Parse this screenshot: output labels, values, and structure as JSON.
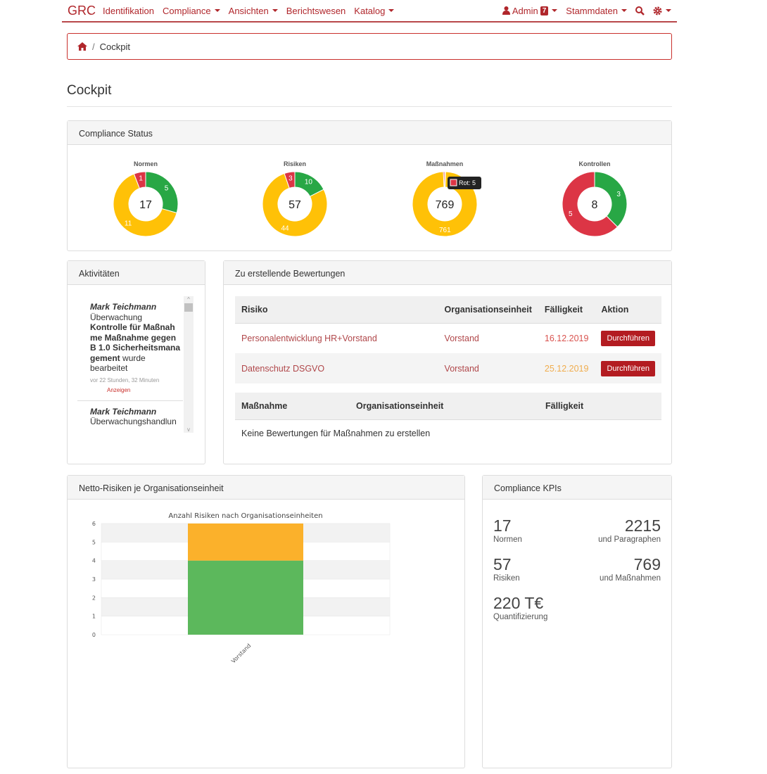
{
  "nav": {
    "brand": "GRC",
    "items": [
      {
        "label": "Identifikation",
        "caret": false
      },
      {
        "label": "Compliance",
        "caret": true
      },
      {
        "label": "Ansichten",
        "caret": true
      },
      {
        "label": "Berichtswesen",
        "caret": false
      },
      {
        "label": "Katalog",
        "caret": true
      }
    ],
    "user": "Admin",
    "user_badge": "7",
    "stammdaten": "Stammdaten",
    "icons": [
      "user-icon",
      "search-icon",
      "gear-icon"
    ]
  },
  "breadcrumb": {
    "current": "Cockpit",
    "icon": "home-icon"
  },
  "page_title": "Cockpit",
  "colors": {
    "green": "#28a745",
    "yellow": "#ffc107",
    "red": "#dc3545",
    "accent": "#b0262b",
    "bar_green": "#5cb85c",
    "bar_orange": "#fbb12b"
  },
  "compliance_status": {
    "title": "Compliance Status",
    "donuts": [
      {
        "title": "Normen",
        "total": "17",
        "segments": [
          {
            "color": "green",
            "value": 5,
            "label": "5"
          },
          {
            "color": "yellow",
            "value": 11,
            "label": "11"
          },
          {
            "color": "red",
            "value": 1,
            "label": "1"
          }
        ]
      },
      {
        "title": "Risiken",
        "total": "57",
        "segments": [
          {
            "color": "green",
            "value": 10,
            "label": "10"
          },
          {
            "color": "yellow",
            "value": 44,
            "label": "44"
          },
          {
            "color": "red",
            "value": 3,
            "label": "3"
          }
        ]
      },
      {
        "title": "Maßnahmen",
        "total": "769",
        "segments": [
          {
            "color": "green",
            "value": 3,
            "label": ""
          },
          {
            "color": "yellow",
            "value": 761,
            "label": "761"
          },
          {
            "color": "red",
            "value": 5,
            "label": ""
          }
        ],
        "tooltip": "Rot: 5"
      },
      {
        "title": "Kontrollen",
        "total": "8",
        "segments": [
          {
            "color": "green",
            "value": 3,
            "label": "3"
          },
          {
            "color": "red",
            "value": 5,
            "label": "5"
          }
        ]
      }
    ]
  },
  "activities": {
    "title": "Aktivitäten",
    "items": [
      {
        "user": "Mark Teichmann",
        "type": "Überwachung",
        "object": "Kontrolle für Maßnahme Maßnahme gegen B 1.0 Sicherheitsmanagement",
        "action": "wurde bearbeitet",
        "time": "vor 22 Stunden, 32 Minuten",
        "link": "Anzeigen"
      },
      {
        "user": "Mark Teichmann",
        "type": "Überwachungshandlun"
      }
    ]
  },
  "assessments": {
    "title": "Zu erstellende Bewertungen",
    "risk_headers": [
      "Risiko",
      "Organisationseinheit",
      "Fälligkeit",
      "Aktion"
    ],
    "risk_rows": [
      {
        "risk": "Personalentwicklung HR+Vorstand",
        "unit": "Vorstand",
        "due": "16.12.2019",
        "due_color": "#d9534f",
        "action": "Durchführen"
      },
      {
        "risk": "Datenschutz DSGVO",
        "unit": "Vorstand",
        "due": "25.12.2019",
        "due_color": "#f0ad4e",
        "action": "Durchführen"
      }
    ],
    "measure_headers": [
      "Maßnahme",
      "Organisationseinheit",
      "Fälligkeit"
    ],
    "measure_empty": "Keine Bewertungen für Maßnahmen zu erstellen"
  },
  "net_risks": {
    "title": "Netto-Risiken je Organisationseinheit"
  },
  "chart_data": {
    "type": "bar",
    "stacked": true,
    "title": "Anzahl Risiken nach Organisationseinheiten",
    "categories": [
      "Vorstand"
    ],
    "series": [
      {
        "color": "#5cb85c",
        "values": [
          4
        ]
      },
      {
        "color": "#fbb12b",
        "values": [
          2
        ]
      }
    ],
    "ylim": [
      0,
      6
    ],
    "yticks": [
      "0",
      "1",
      "2",
      "3",
      "4",
      "5",
      "6"
    ],
    "grid": "banded"
  },
  "kpis": {
    "title": "Compliance KPIs",
    "items": [
      {
        "left_value": "17",
        "left_label": "Normen",
        "right_value": "2215",
        "right_label": "und Paragraphen"
      },
      {
        "left_value": "57",
        "left_label": "Risiken",
        "right_value": "769",
        "right_label": "und Maßnahmen"
      },
      {
        "left_value": "220 T€",
        "left_label": "Quantifizierung"
      }
    ]
  }
}
